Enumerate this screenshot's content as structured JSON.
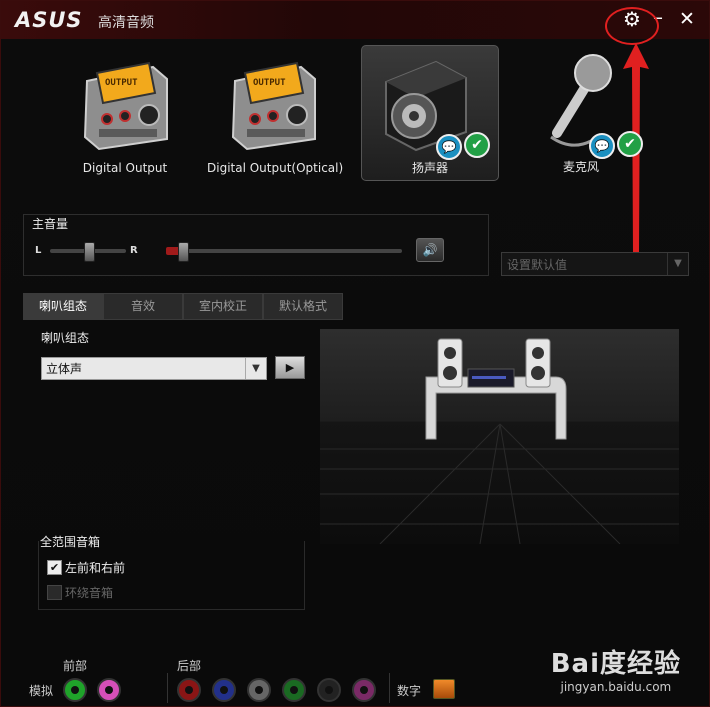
{
  "titlebar": {
    "brand": "ASUS",
    "title": "高清音频"
  },
  "devices": [
    {
      "label": "Digital Output",
      "selected": false
    },
    {
      "label": "Digital Output(Optical)",
      "selected": false
    },
    {
      "label": "扬声器",
      "selected": true
    },
    {
      "label": "麦克风",
      "selected": false
    }
  ],
  "master_volume": {
    "title": "主音量",
    "left_label": "L",
    "right_label": "R"
  },
  "default_dropdown": {
    "label": "设置默认值"
  },
  "tabs": [
    {
      "label": "喇叭组态",
      "active": true
    },
    {
      "label": "音效",
      "active": false
    },
    {
      "label": "室内校正",
      "active": false
    },
    {
      "label": "默认格式",
      "active": false
    }
  ],
  "speaker_config": {
    "label": "喇叭组态",
    "selected_value": "立体声"
  },
  "full_range": {
    "title": "全范围音箱",
    "options": [
      {
        "label": "左前和右前",
        "checked": true,
        "disabled": false
      },
      {
        "label": "环绕音箱",
        "checked": false,
        "disabled": true
      }
    ]
  },
  "jacks": {
    "front_label": "前部",
    "rear_label": "后部",
    "analog_label": "模拟",
    "digital_label": "数字",
    "front_colors": [
      "#1fa32a",
      "#d64fb8"
    ],
    "rear_colors": [
      "#8a1515",
      "#22308a",
      "#666666",
      "#1a6a22",
      "#222222",
      "#7a2a66"
    ]
  },
  "watermark": {
    "logo": "Bai度经验",
    "url": "jingyan.baidu.com"
  },
  "colors": {
    "accent": "#e02020",
    "title_bg": "#3a0b0b"
  }
}
